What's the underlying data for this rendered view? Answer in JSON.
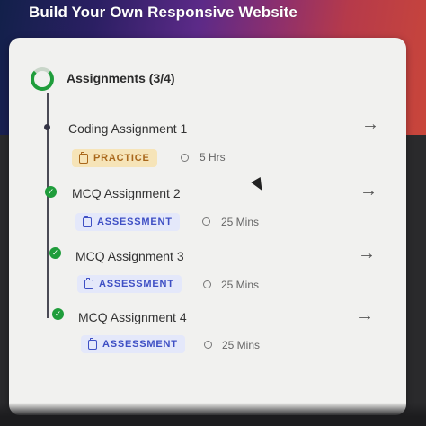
{
  "banner": {
    "title": "Build Your Own Responsive Website"
  },
  "section": {
    "title": "Assignments (3/4)"
  },
  "items": [
    {
      "title": "Coding Assignment 1",
      "tag": "PRACTICE",
      "duration": "5 Hrs",
      "completed": false
    },
    {
      "title": "MCQ Assignment 2",
      "tag": "ASSESSMENT",
      "duration": "25 Mins",
      "completed": true
    },
    {
      "title": "MCQ Assignment 3",
      "tag": "ASSESSMENT",
      "duration": "25 Mins",
      "completed": true
    },
    {
      "title": "MCQ Assignment 4",
      "tag": "ASSESSMENT",
      "duration": "25 Mins",
      "completed": true
    }
  ],
  "icons": {
    "arrow": "→",
    "check": "✓"
  },
  "colors": {
    "success": "#1f9d3b",
    "practice_bg": "#f6e4b8",
    "practice_fg": "#a9671b",
    "assess_bg": "#e4e8fa",
    "assess_fg": "#3e4fc4"
  }
}
